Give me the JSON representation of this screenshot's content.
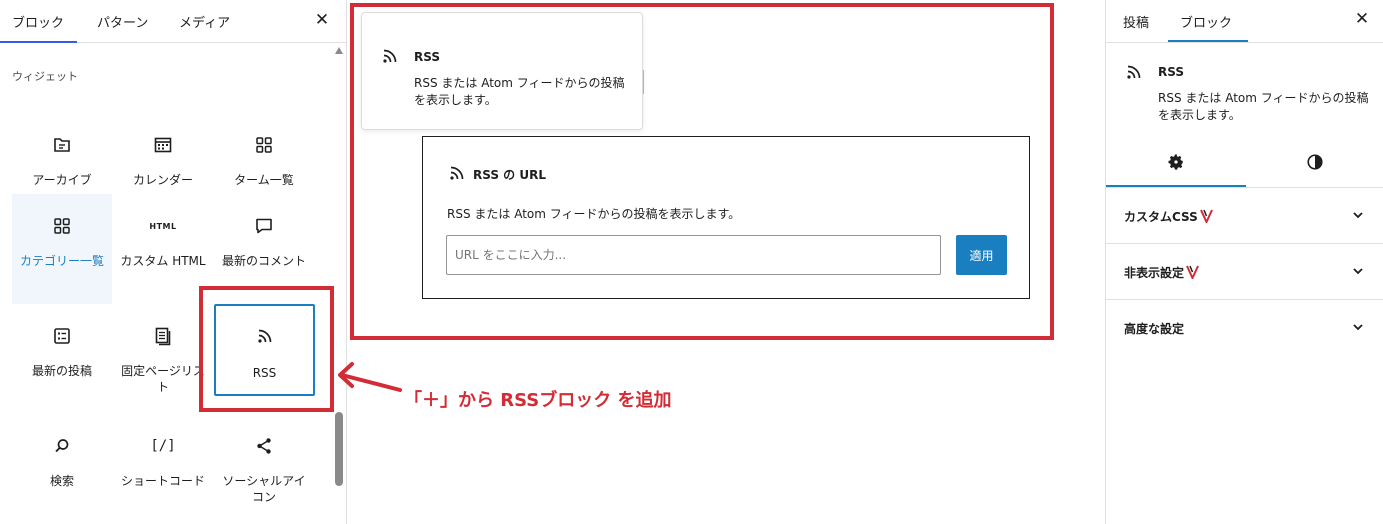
{
  "inserter": {
    "tabs": [
      {
        "label": "ブロック",
        "active": true
      },
      {
        "label": "パターン",
        "active": false
      },
      {
        "label": "メディア",
        "active": false
      }
    ],
    "close_icon": "close-icon",
    "section_label": "ウィジェット",
    "blocks": [
      {
        "label": "アーカイブ",
        "icon": "archive-icon"
      },
      {
        "label": "カレンダー",
        "icon": "calendar-icon"
      },
      {
        "label": "ターム一覧",
        "icon": "grid-icon"
      },
      {
        "label": "カテゴリー一覧",
        "icon": "grid-icon",
        "active": true
      },
      {
        "label": "カスタム HTML",
        "icon": "html-icon",
        "icon_text": "HTML"
      },
      {
        "label": "最新のコメント",
        "icon": "comment-icon"
      },
      {
        "label": "最新の投稿",
        "icon": "list-icon"
      },
      {
        "label": "固定ページリスト",
        "icon": "pages-icon"
      },
      {
        "label": "RSS",
        "icon": "rss-icon",
        "highlighted": true
      },
      {
        "label": "検索",
        "icon": "search-icon"
      },
      {
        "label": "ショートコード",
        "icon": "shortcode-icon",
        "icon_text": "[/]"
      },
      {
        "label": "ソーシャルアイコン",
        "icon": "share-icon"
      }
    ]
  },
  "popover": {
    "title": "RSS",
    "description": "RSS または Atom フィードからの投稿を表示します。"
  },
  "block": {
    "title": "RSS の URL",
    "description": "RSS または Atom フィードからの投稿を表示します。",
    "url_placeholder": "URL をここに入力...",
    "apply_label": "適用"
  },
  "annotation": {
    "text": "「＋」から RSSブロック を追加",
    "color": "#d22c36"
  },
  "sidebar": {
    "tabs": [
      {
        "label": "投稿",
        "active": false
      },
      {
        "label": "ブロック",
        "active": true
      }
    ],
    "close_icon": "close-icon",
    "block_card": {
      "title": "RSS",
      "description": "RSS または Atom フィードからの投稿を表示します。"
    },
    "sub_tabs": [
      "settings-icon",
      "styles-icon"
    ],
    "panels": [
      {
        "title": "カスタムCSS"
      },
      {
        "title": "非表示設定"
      },
      {
        "title": "高度な設定"
      }
    ]
  },
  "colors": {
    "accent": "#1a7fc1",
    "highlight_red": "#d22c36",
    "tab_underline": "#3858e9"
  }
}
